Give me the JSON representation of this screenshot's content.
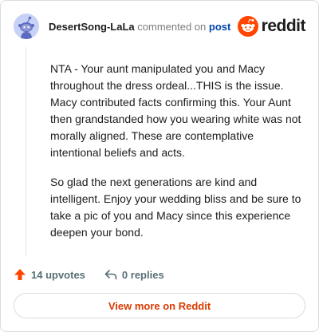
{
  "header": {
    "username": "DesertSong-LaLa",
    "action_text": "commented on",
    "post_link": "post",
    "logo_text": "reddit"
  },
  "comment": {
    "paragraphs": [
      "NTA - Your aunt manipulated you and Macy throughout the dress ordeal...THIS is the issue. Macy contributed facts confirming this. Your Aunt then grandstanded how you wearing white was not morally aligned. These are contemplative intentional beliefs and acts.",
      "So glad the next generations are kind and intelligent. Enjoy your wedding bliss and be sure to take a pic of you and Macy since this experience deepen your bond."
    ]
  },
  "actions": {
    "upvotes": "14 upvotes",
    "replies": "0 replies"
  },
  "footer": {
    "button_label": "View more on Reddit"
  },
  "colors": {
    "brand": "#ff4500",
    "link": "#0045ac",
    "button_text": "#d93a00"
  },
  "icons": {
    "avatar": "snoo-avatar-icon",
    "logo": "reddit-logo-icon",
    "upvote": "upvote-arrow-icon",
    "reply": "reply-arrow-icon"
  }
}
